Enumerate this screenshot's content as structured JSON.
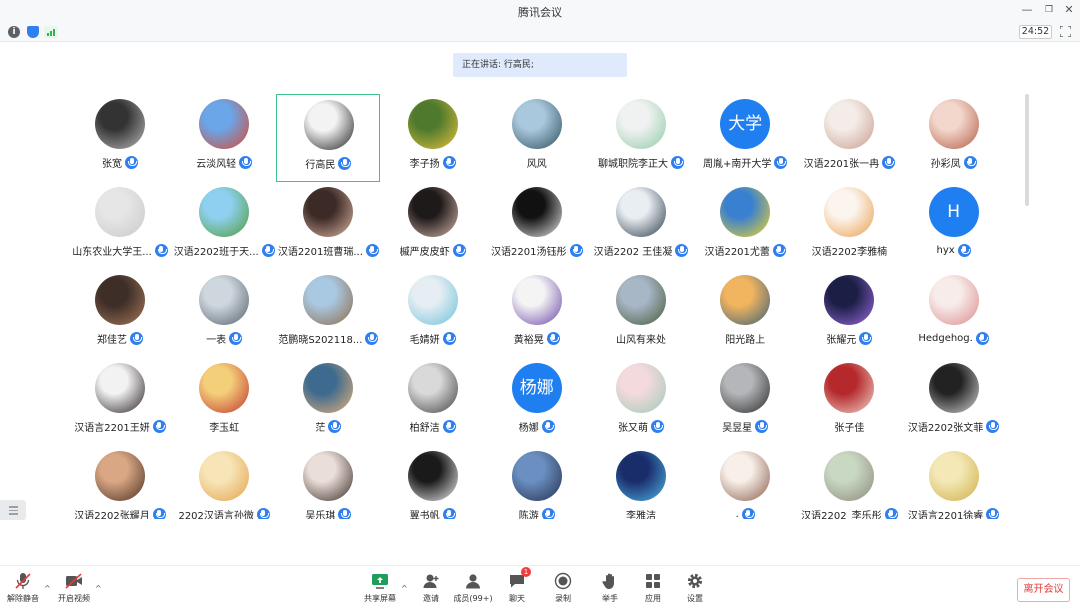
{
  "window": {
    "title": "腾讯会议"
  },
  "infobar": {
    "timer": "24:52"
  },
  "speaking": {
    "text": "正在讲话: 行高民;"
  },
  "participants": [
    {
      "name": "张宽",
      "colors": [
        "#333333",
        "#bbbbbb"
      ],
      "mic": true
    },
    {
      "name": "云淡风轻",
      "colors": [
        "#6aa6e8",
        "#d9462f"
      ],
      "mic": true
    },
    {
      "name": "行高民",
      "colors": [
        "#f3f3f3",
        "#202020"
      ],
      "mic": true,
      "active": true
    },
    {
      "name": "李子扬",
      "colors": [
        "#4f7a2e",
        "#e6c23c"
      ],
      "mic": true
    },
    {
      "name": "风风",
      "colors": [
        "#a9c8dd",
        "#2e4e5c"
      ],
      "mic": false
    },
    {
      "name": "聊城职院李正大",
      "colors": [
        "#f0f2f1",
        "#8fc9a6"
      ],
      "mic": true
    },
    {
      "name": "周胤+南开大学",
      "avatar_text": "大学",
      "colors": [
        "#1f7ff0",
        "#1f7ff0"
      ],
      "mic": true
    },
    {
      "name": "汉语2201张一冉",
      "colors": [
        "#f4ece8",
        "#c99c8d"
      ],
      "mic": true
    },
    {
      "name": "孙彩凤",
      "colors": [
        "#f3d6cc",
        "#b35d46"
      ],
      "mic": true
    },
    {
      "name": "山东农业大学王...",
      "colors": [
        "#e6e6e6",
        "#c9c9c9"
      ],
      "mic": true
    },
    {
      "name": "汉语2202班于天...",
      "colors": [
        "#8fd0f0",
        "#4f9b35"
      ],
      "mic": true
    },
    {
      "name": "汉语2201班曹瑞...",
      "colors": [
        "#3b2a26",
        "#e0b7a2"
      ],
      "mic": true
    },
    {
      "name": "槭严皮皮虾",
      "colors": [
        "#1e1a1a",
        "#d8b7aa"
      ],
      "mic": true
    },
    {
      "name": "汉语2201汤钰彤",
      "colors": [
        "#111111",
        "#e8e8e8"
      ],
      "mic": true
    },
    {
      "name": "汉语2202 王佳凝",
      "colors": [
        "#e9eef3",
        "#2a3a48"
      ],
      "mic": true
    },
    {
      "name": "汉语2201尤蕾",
      "colors": [
        "#3a80d0",
        "#f0d62a"
      ],
      "mic": true
    },
    {
      "name": "汉语2202李雅楠",
      "colors": [
        "#fbf5ee",
        "#e99d4d"
      ],
      "mic": false
    },
    {
      "name": "hyx",
      "avatar_text": "H",
      "colors": [
        "#1f7ff0",
        "#1f7ff0"
      ],
      "mic": true
    },
    {
      "name": "郑佳艺",
      "colors": [
        "#3e2e28",
        "#a77a5a"
      ],
      "mic": true
    },
    {
      "name": "一表",
      "colors": [
        "#cfd7de",
        "#56616b"
      ],
      "mic": true
    },
    {
      "name": "范鹏晓S202118...",
      "colors": [
        "#a9c8e2",
        "#8d6a47"
      ],
      "mic": true
    },
    {
      "name": "毛婧妍",
      "colors": [
        "#e6eef3",
        "#6cc0d8"
      ],
      "mic": true
    },
    {
      "name": "黄裕晃",
      "colors": [
        "#f4f4f4",
        "#6a45a8"
      ],
      "mic": true
    },
    {
      "name": "山风有来处",
      "colors": [
        "#a8b7c6",
        "#475a3a"
      ],
      "mic": false
    },
    {
      "name": "阳光路上",
      "colors": [
        "#f2b55f",
        "#3a5e78"
      ],
      "mic": false
    },
    {
      "name": "张耀元",
      "colors": [
        "#1b1e45",
        "#9b6be0"
      ],
      "mic": true
    },
    {
      "name": "Hedgehog.",
      "colors": [
        "#f7ecea",
        "#d98a8a"
      ],
      "mic": true
    },
    {
      "name": "汉语言2201王妍",
      "colors": [
        "#f2f2f2",
        "#2a2226"
      ],
      "mic": true
    },
    {
      "name": "李玉虹",
      "colors": [
        "#f4cf7a",
        "#c0342f"
      ],
      "mic": false
    },
    {
      "name": "茫",
      "colors": [
        "#3d6a8e",
        "#e8b27a"
      ],
      "mic": true
    },
    {
      "name": "柏舒洁",
      "colors": [
        "#d9d9d9",
        "#404040"
      ],
      "mic": true
    },
    {
      "name": "杨娜",
      "avatar_text": "杨娜",
      "colors": [
        "#1f7ff0",
        "#1f7ff0"
      ],
      "mic": true
    },
    {
      "name": "张又萌",
      "colors": [
        "#f4d9dd",
        "#9dcbb7"
      ],
      "mic": true
    },
    {
      "name": "吴昱星",
      "colors": [
        "#b4b6b9",
        "#2a2a2a"
      ],
      "mic": true
    },
    {
      "name": "张子佳",
      "colors": [
        "#b5282c",
        "#f1d7c9"
      ],
      "mic": false
    },
    {
      "name": "汉语2202张文菲",
      "colors": [
        "#222222",
        "#d6d6d6"
      ],
      "mic": true
    },
    {
      "name": "汉语2202张耀月",
      "colors": [
        "#d9a784",
        "#4a3020"
      ],
      "mic": true
    },
    {
      "name": "2202汉语言孙微",
      "colors": [
        "#f7e5b8",
        "#e5a14a"
      ],
      "mic": true
    },
    {
      "name": "吴乐琪",
      "colors": [
        "#eaded8",
        "#3a2a26"
      ],
      "mic": true
    },
    {
      "name": "翼书帆",
      "colors": [
        "#1a1a1a",
        "#efefef"
      ],
      "mic": true
    },
    {
      "name": "陈游",
      "colors": [
        "#6a8fc0",
        "#23304f"
      ],
      "mic": true
    },
    {
      "name": "李雅洁",
      "colors": [
        "#1a2d6b",
        "#4fb6e8"
      ],
      "mic": false
    },
    {
      "name": ".",
      "colors": [
        "#f7efe8",
        "#8a5b4a"
      ],
      "mic": true
    },
    {
      "name": "汉语2202_李乐彤",
      "colors": [
        "#c9d8c2",
        "#8a8a7a"
      ],
      "mic": true
    },
    {
      "name": "汉语言2201徐睿",
      "colors": [
        "#f3e8b6",
        "#cfae47"
      ],
      "mic": true
    }
  ],
  "toolbar": {
    "unmute": "解除静音",
    "start_video": "开启视频",
    "share_screen": "共享屏幕",
    "invite": "邀请",
    "members": "成员(99+)",
    "chat": "聊天",
    "chat_badge": "1",
    "record": "录制",
    "raise_hand": "举手",
    "apps": "应用",
    "settings": "设置",
    "leave": "离开会议"
  }
}
